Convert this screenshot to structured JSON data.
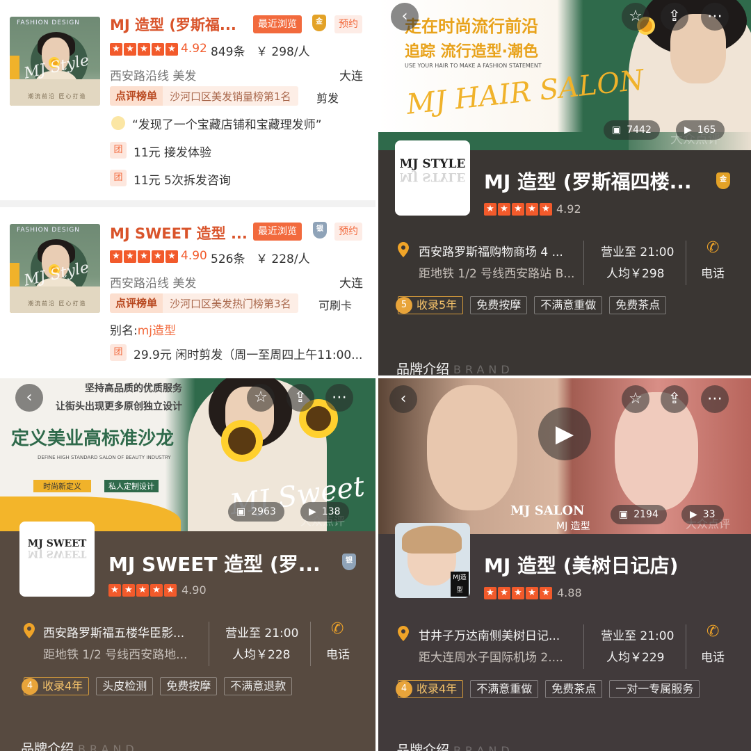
{
  "listings": [
    {
      "name": "MJ 造型 (罗斯福...",
      "recent_badge": "最近浏览",
      "medal": "金",
      "book_badge": "预约",
      "rating": "4.92",
      "reviews": "849条",
      "price": "￥ 298/人",
      "area": "西安路沿线 美发",
      "city": "大连",
      "rank_title": "点评榜单",
      "rank_text": "沙河口区美发销量榜第1名",
      "right_tag": "剪发",
      "quote": "“发现了一个宝藏店铺和宝藏理发师”",
      "deal_icon": "团",
      "deals": [
        "11元 接发体验",
        "11元 5次拆发咨询"
      ],
      "thumb_caption": "FASHION DESIGN",
      "thumb_script": "MJ Style",
      "thumb_tagline": "潮流前沿 匠心打造"
    },
    {
      "name": "MJ SWEET 造型 ...",
      "recent_badge": "最近浏览",
      "medal": "银",
      "book_badge": "预约",
      "rating": "4.90",
      "reviews": "526条",
      "price": "￥ 228/人",
      "area": "西安路沿线 美发",
      "city": "大连",
      "rank_title": "点评榜单",
      "rank_text": "沙河口区美发热门榜第3名",
      "right_tag": "可刷卡",
      "alias_label": "别名:",
      "alias_value": "mj造型",
      "deal_icon": "团",
      "deals": [
        "29.9元 闲时剪发（周一至周四上午11:00..."
      ],
      "thumb_caption": "FASHION DESIGN",
      "thumb_script": "MJ Style",
      "thumb_tagline": "潮流前沿 匠心打造"
    }
  ],
  "details": [
    {
      "hero_text1": "走在时尚流行前沿",
      "hero_text2": "追踪 流行造型·潮色",
      "hero_small": "USE YOUR HAIR TO MAKE A FASHION STATEMENT",
      "hero_script": "MJ HAIR SALON",
      "photos": "7442",
      "videos": "165",
      "logo": "MJ STYLE",
      "name": "MJ 造型 (罗斯福四楼...",
      "medal": "金",
      "rating": "4.92",
      "addr1": "西安路罗斯福购物商场 4 ...",
      "addr2": "距地铁 1/2 号线西安路站 B...",
      "hours": "营业至 21:00",
      "avg": "人均￥298",
      "phone": "电话",
      "years_num": "5",
      "years": "收录5年",
      "tags": [
        "免费按摩",
        "不满意重做",
        "免费茶点"
      ],
      "brand": "品牌介绍",
      "brand_en": "BRAND"
    },
    {
      "hero_text1": "坚持高品质的优质服务",
      "hero_text2": "让街头出现更多原创独立设计",
      "hero_big": "定义美业高标准沙龙",
      "hero_small": "DEFINE HIGH STANDARD SALON OF BEAUTY INDUSTRY",
      "chip1": "时尚新定义",
      "chip2": "私人定制设计",
      "hero_script": "MJ Sweet",
      "photos": "2963",
      "videos": "138",
      "logo": "MJ SWEET",
      "name": "MJ SWEET 造型 (罗...",
      "medal": "银",
      "rating": "4.90",
      "addr1": "西安路罗斯福五楼华臣影...",
      "addr2": "距地铁 1/2 号线西安路地...",
      "hours": "营业至 21:00",
      "avg": "人均￥228",
      "phone": "电话",
      "years_num": "4",
      "years": "收录4年",
      "tags": [
        "头皮检测",
        "免费按摩",
        "不满意退款"
      ],
      "brand": "品牌介绍",
      "brand_en": "BRAND"
    },
    {
      "photos": "2194",
      "videos": "33",
      "logo_badge": "MJ造型",
      "hero_script": "MJ SALON",
      "hero_script2": "MJ 造型",
      "name": "MJ 造型 (美树日记店)",
      "rating": "4.88",
      "addr1": "甘井子万达南侧美树日记...",
      "addr2": "距大连周水子国际机场 2....",
      "hours": "营业至 21:00",
      "avg": "人均￥229",
      "phone": "电话",
      "years_num": "4",
      "years": "收录4年",
      "tags": [
        "不满意重做",
        "免费茶点",
        "一对一专属服务"
      ],
      "brand": "品牌介绍",
      "brand_en": "BRAND"
    }
  ],
  "watermark": "大众点评",
  "icons": {
    "back": "chevron-left-icon",
    "star": "star-outline-icon",
    "share": "share-icon",
    "more": "more-icon",
    "photo": "photo-icon",
    "video": "video-icon",
    "pin": "location-pin-icon",
    "phone": "phone-icon",
    "play": "play-icon"
  },
  "colors": {
    "accent": "#f25a2b",
    "gold": "#e3a227"
  }
}
